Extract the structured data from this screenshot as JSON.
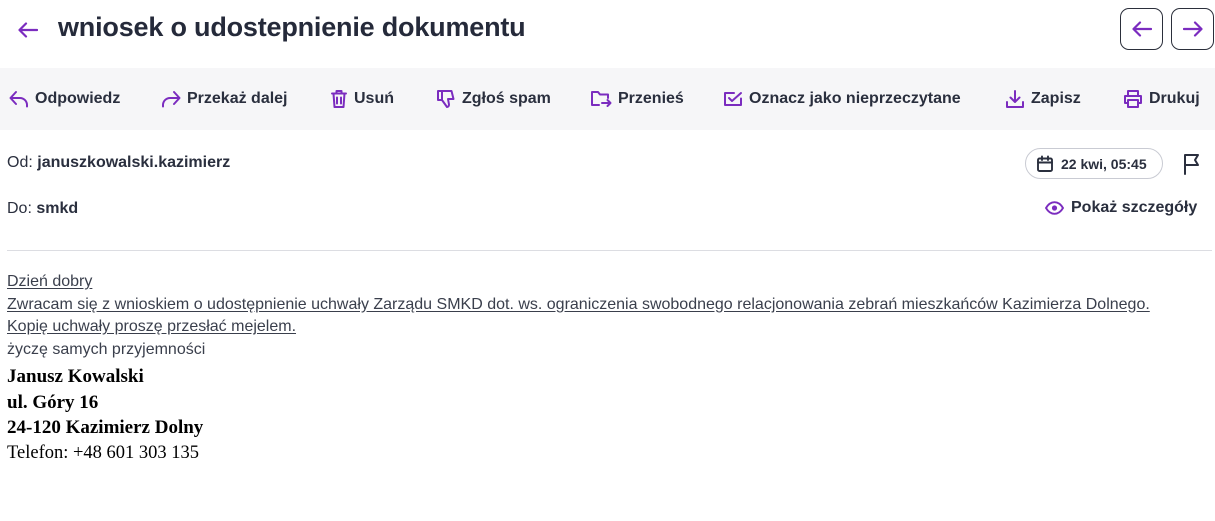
{
  "header": {
    "title": "wniosek o udostepnienie dokumentu"
  },
  "toolbar": [
    {
      "name": "reply",
      "label": "Odpowiedz",
      "icon": "reply-icon"
    },
    {
      "name": "forward",
      "label": "Przekaż dalej",
      "icon": "forward-icon"
    },
    {
      "name": "delete",
      "label": "Usuń",
      "icon": "trash-icon"
    },
    {
      "name": "spam",
      "label": "Zgłoś spam",
      "icon": "thumbs-down-icon"
    },
    {
      "name": "move",
      "label": "Przenieś",
      "icon": "move-folder-icon"
    },
    {
      "name": "mark-unread",
      "label": "Oznacz jako nieprzeczytane",
      "icon": "mail-check-icon"
    },
    {
      "name": "save",
      "label": "Zapisz",
      "icon": "download-icon"
    },
    {
      "name": "print",
      "label": "Drukuj",
      "icon": "printer-icon"
    }
  ],
  "meta": {
    "from_label": "Od:",
    "from_value": "januszkowalski.kazimierz",
    "to_label": "Do:",
    "to_value": "smkd",
    "date": "22 kwi, 05:45",
    "details_label": "Pokaż szczegóły"
  },
  "message": {
    "greeting": "Dzień dobry",
    "line1": "Zwracam się z wnioskiem o udostępnienie uchwały Zarządu SMKD dot. ws. ograniczenia swobodnego relacjonowania zebrań mieszkańców Kazimierza Dolnego.",
    "line2": "Kopię uchwały proszę przesłać mejelem.",
    "closing": "życzę samych przyjemności",
    "signature": {
      "name": "Janusz Kowalski",
      "street": "ul. Góry 16",
      "city": "24-120 Kazimierz Dolny",
      "phone": "Telefon: +48 601 303 135"
    }
  },
  "colors": {
    "accent": "#7b2cbf",
    "text": "#2a2f3e",
    "toolbar_bg": "#f6f6f8"
  }
}
